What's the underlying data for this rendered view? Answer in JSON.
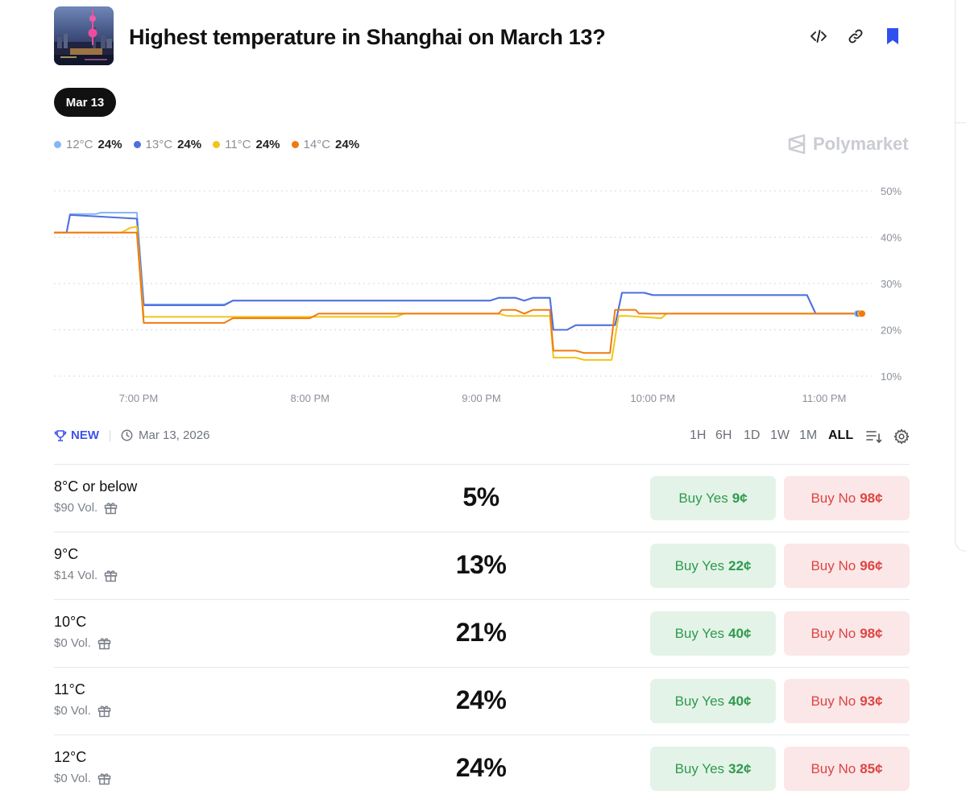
{
  "header": {
    "title": "Highest temperature in Shanghai on March 13?",
    "icons": [
      "embed-code-icon",
      "link-icon",
      "bookmark-icon"
    ]
  },
  "date_pill": "Mar 13",
  "legend": [
    {
      "name": "12°C",
      "value": "24%",
      "color": "#86b6f6"
    },
    {
      "name": "13°C",
      "value": "24%",
      "color": "#4e6fe0"
    },
    {
      "name": "11°C",
      "value": "24%",
      "color": "#f2c418"
    },
    {
      "name": "14°C",
      "value": "24%",
      "color": "#f07a10"
    }
  ],
  "watermark": "Polymarket",
  "chart_data": {
    "type": "line",
    "x_ticks": [
      "7:00 PM",
      "8:00 PM",
      "9:00 PM",
      "10:00 PM",
      "11:00 PM"
    ],
    "y_ticks": [
      "50%",
      "40%",
      "30%",
      "20%",
      "10%"
    ],
    "ylim": [
      10,
      50
    ],
    "xlim": [
      18.5,
      23.2
    ],
    "grid": true,
    "legend_position": "top-left",
    "series": [
      {
        "name": "12°C",
        "color": "#86b6f6",
        "points": [
          [
            18.5,
            41
          ],
          [
            18.58,
            41
          ],
          [
            18.6,
            45
          ],
          [
            18.75,
            45
          ],
          [
            18.78,
            45.3
          ],
          [
            18.99,
            45.3
          ],
          [
            19.03,
            25.5
          ],
          [
            19.5,
            25.5
          ],
          [
            19.55,
            26.3
          ],
          [
            20.5,
            26.3
          ],
          [
            21.05,
            26.3
          ],
          [
            21.1,
            26.9
          ],
          [
            21.2,
            26.9
          ],
          [
            21.25,
            26.3
          ],
          [
            21.3,
            26.9
          ],
          [
            21.4,
            26.9
          ],
          [
            21.42,
            20
          ],
          [
            21.5,
            20
          ],
          [
            21.55,
            21
          ],
          [
            21.78,
            21
          ],
          [
            21.82,
            28
          ],
          [
            21.95,
            28
          ],
          [
            22,
            27.5
          ],
          [
            22.9,
            27.5
          ],
          [
            22.95,
            23.5
          ],
          [
            23.2,
            23.5
          ]
        ]
      },
      {
        "name": "13°C",
        "color": "#4e6fe0",
        "points": [
          [
            18.5,
            41
          ],
          [
            18.58,
            41
          ],
          [
            18.6,
            44.8
          ],
          [
            18.75,
            44.5
          ],
          [
            18.99,
            44
          ],
          [
            19.03,
            25.3
          ],
          [
            19.5,
            25.3
          ],
          [
            19.55,
            26.3
          ],
          [
            21.05,
            26.3
          ],
          [
            21.1,
            26.9
          ],
          [
            21.2,
            26.9
          ],
          [
            21.25,
            26.3
          ],
          [
            21.3,
            26.9
          ],
          [
            21.4,
            26.9
          ],
          [
            21.42,
            20
          ],
          [
            21.5,
            20
          ],
          [
            21.55,
            21
          ],
          [
            21.78,
            21
          ],
          [
            21.82,
            28
          ],
          [
            21.95,
            28
          ],
          [
            22,
            27.5
          ],
          [
            22.9,
            27.5
          ],
          [
            22.95,
            23.5
          ],
          [
            23.2,
            23.5
          ]
        ]
      },
      {
        "name": "11°C",
        "color": "#f2c418",
        "points": [
          [
            18.5,
            41
          ],
          [
            18.9,
            41
          ],
          [
            18.95,
            42
          ],
          [
            18.99,
            42.3
          ],
          [
            19.03,
            22.8
          ],
          [
            20.5,
            22.8
          ],
          [
            20.55,
            23.5
          ],
          [
            21.1,
            23.5
          ],
          [
            21.15,
            23
          ],
          [
            21.3,
            23
          ],
          [
            21.4,
            23
          ],
          [
            21.42,
            14
          ],
          [
            21.55,
            14
          ],
          [
            21.6,
            13.5
          ],
          [
            21.76,
            13.5
          ],
          [
            21.8,
            23
          ],
          [
            21.85,
            23
          ],
          [
            22.05,
            22.5
          ],
          [
            22.08,
            23.5
          ],
          [
            23.2,
            23.5
          ]
        ]
      },
      {
        "name": "14°C",
        "color": "#f07a10",
        "points": [
          [
            18.5,
            41
          ],
          [
            18.99,
            41
          ],
          [
            19.03,
            21.5
          ],
          [
            19.5,
            21.5
          ],
          [
            19.55,
            22.5
          ],
          [
            20,
            22.5
          ],
          [
            20.05,
            23.5
          ],
          [
            21.1,
            23.5
          ],
          [
            21.12,
            24.3
          ],
          [
            21.2,
            24.3
          ],
          [
            21.25,
            23.5
          ],
          [
            21.3,
            24.3
          ],
          [
            21.4,
            24.3
          ],
          [
            21.42,
            15.5
          ],
          [
            21.55,
            15.5
          ],
          [
            21.6,
            15
          ],
          [
            21.75,
            15
          ],
          [
            21.78,
            24.3
          ],
          [
            21.9,
            24.3
          ],
          [
            21.92,
            23.5
          ],
          [
            23.2,
            23.5
          ]
        ]
      }
    ]
  },
  "meta": {
    "new_label": "NEW",
    "date": "Mar 13, 2026"
  },
  "time_ranges": [
    "1H",
    "6H",
    "1D",
    "1W",
    "1M",
    "ALL"
  ],
  "active_range": "ALL",
  "rows": [
    {
      "name": "8°C or below",
      "volume": "$90 Vol.",
      "percent": "5%",
      "yes_label": "Buy Yes",
      "yes_price": "9¢",
      "no_label": "Buy No",
      "no_price": "98¢"
    },
    {
      "name": "9°C",
      "volume": "$14 Vol.",
      "percent": "13%",
      "yes_label": "Buy Yes",
      "yes_price": "22¢",
      "no_label": "Buy No",
      "no_price": "96¢"
    },
    {
      "name": "10°C",
      "volume": "$0 Vol.",
      "percent": "21%",
      "yes_label": "Buy Yes",
      "yes_price": "40¢",
      "no_label": "Buy No",
      "no_price": "98¢"
    },
    {
      "name": "11°C",
      "volume": "$0 Vol.",
      "percent": "24%",
      "yes_label": "Buy Yes",
      "yes_price": "40¢",
      "no_label": "Buy No",
      "no_price": "93¢"
    },
    {
      "name": "12°C",
      "volume": "$0 Vol.",
      "percent": "24%",
      "yes_label": "Buy Yes",
      "yes_price": "32¢",
      "no_label": "Buy No",
      "no_price": "85¢"
    }
  ]
}
